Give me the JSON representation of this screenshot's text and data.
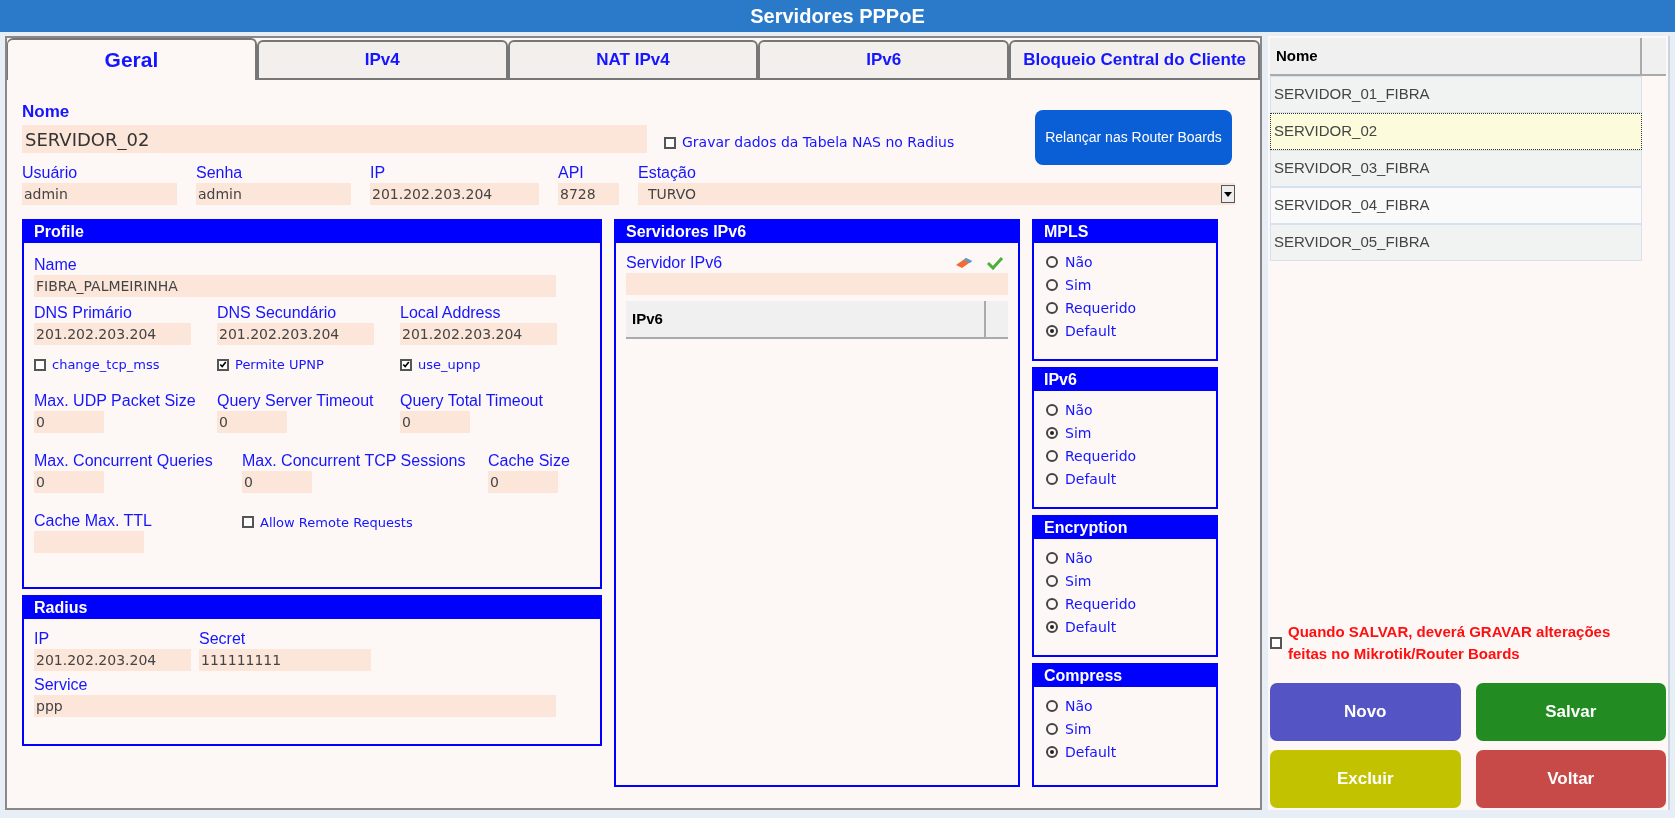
{
  "title": "Servidores PPPoE",
  "tabs": [
    {
      "label": "Geral",
      "selected": true
    },
    {
      "label": "IPv4",
      "selected": false
    },
    {
      "label": "NAT IPv4",
      "selected": false
    },
    {
      "label": "IPv6",
      "selected": false
    },
    {
      "label": "Bloqueio Central do Cliente",
      "selected": false
    }
  ],
  "form": {
    "nome": {
      "label": "Nome",
      "value": "SERVIDOR_02"
    },
    "gravar_nas": {
      "label": "Gravar dados da Tabela NAS no Radius",
      "checked": false
    },
    "relancar_button": "Relançar nas Router Boards",
    "fields": [
      {
        "label": "Usuário",
        "value": "admin"
      },
      {
        "label": "Senha",
        "value": "admin"
      },
      {
        "label": "IP",
        "value": "201.202.203.204"
      },
      {
        "label": "API",
        "value": "8728"
      }
    ],
    "estacao": {
      "label": "Estação",
      "value": "TURVO"
    }
  },
  "profile": {
    "title": "Profile",
    "name": {
      "label": "Name",
      "value": "FIBRA_PALMEIRINHA"
    },
    "dns": [
      {
        "label": "DNS Primário",
        "value": "201.202.203.204"
      },
      {
        "label": "DNS Secundário",
        "value": "201.202.203.204"
      },
      {
        "label": "Local Address",
        "value": "201.202.203.204"
      }
    ],
    "checkboxes": [
      {
        "label": "change_tcp_mss",
        "checked": false
      },
      {
        "label": "Permite UPNP",
        "checked": true
      },
      {
        "label": "use_upnp",
        "checked": true
      }
    ],
    "timeouts": [
      {
        "label": "Max. UDP Packet Size",
        "value": "0"
      },
      {
        "label": "Query Server Timeout",
        "value": "0"
      },
      {
        "label": "Query Total Timeout",
        "value": "0"
      }
    ],
    "concurrent": [
      {
        "label": "Max. Concurrent Queries",
        "value": "0"
      },
      {
        "label": "Max. Concurrent TCP Sessions",
        "value": "0"
      },
      {
        "label": "Cache Size",
        "value": "0"
      }
    ],
    "cache_max_ttl": {
      "label": "Cache Max. TTL"
    },
    "allow_remote": {
      "label": "Allow Remote Requests",
      "checked": false
    }
  },
  "radius": {
    "title": "Radius",
    "fields": [
      {
        "label": "IP",
        "value": "201.202.203.204"
      },
      {
        "label": "Secret",
        "value": "111111111"
      }
    ],
    "service": {
      "label": "Service",
      "value": "ppp"
    }
  },
  "ipv6_servers": {
    "title": "Servidores IPv6",
    "field_label": "Servidor IPv6",
    "column": "IPv6"
  },
  "option_groups": [
    {
      "title": "MPLS",
      "options": [
        {
          "label": "Não",
          "selected": false
        },
        {
          "label": "Sim",
          "selected": false
        },
        {
          "label": "Requerido",
          "selected": false
        },
        {
          "label": "Default",
          "selected": true
        }
      ]
    },
    {
      "title": "IPv6",
      "options": [
        {
          "label": "Não",
          "selected": false
        },
        {
          "label": "Sim",
          "selected": true
        },
        {
          "label": "Requerido",
          "selected": false
        },
        {
          "label": "Default",
          "selected": false
        }
      ]
    },
    {
      "title": "Encryption",
      "options": [
        {
          "label": "Não",
          "selected": false
        },
        {
          "label": "Sim",
          "selected": false
        },
        {
          "label": "Requerido",
          "selected": false
        },
        {
          "label": "Default",
          "selected": true
        }
      ]
    },
    {
      "title": "Compress",
      "options": [
        {
          "label": "Não",
          "selected": false
        },
        {
          "label": "Sim",
          "selected": false
        },
        {
          "label": "Default",
          "selected": true
        }
      ]
    }
  ],
  "server_list": {
    "column": "Nome",
    "rows": [
      {
        "name": "SERVIDOR_01_FIBRA",
        "selected": false
      },
      {
        "name": "SERVIDOR_02",
        "selected": true
      },
      {
        "name": "SERVIDOR_03_FIBRA",
        "selected": false
      },
      {
        "name": "SERVIDOR_04_FIBRA",
        "selected": false
      },
      {
        "name": "SERVIDOR_05_FIBRA",
        "selected": false
      }
    ]
  },
  "save_notice": {
    "label": "Quando SALVAR, deverá GRAVAR alterações feitas no Mikrotik/Router Boards",
    "checked": false
  },
  "buttons": [
    {
      "label": "Novo",
      "color": "#5454c4"
    },
    {
      "label": "Salvar",
      "color": "#228b22"
    },
    {
      "label": "Excluir",
      "color": "#c2c200"
    },
    {
      "label": "Voltar",
      "color": "#c84a48"
    }
  ]
}
